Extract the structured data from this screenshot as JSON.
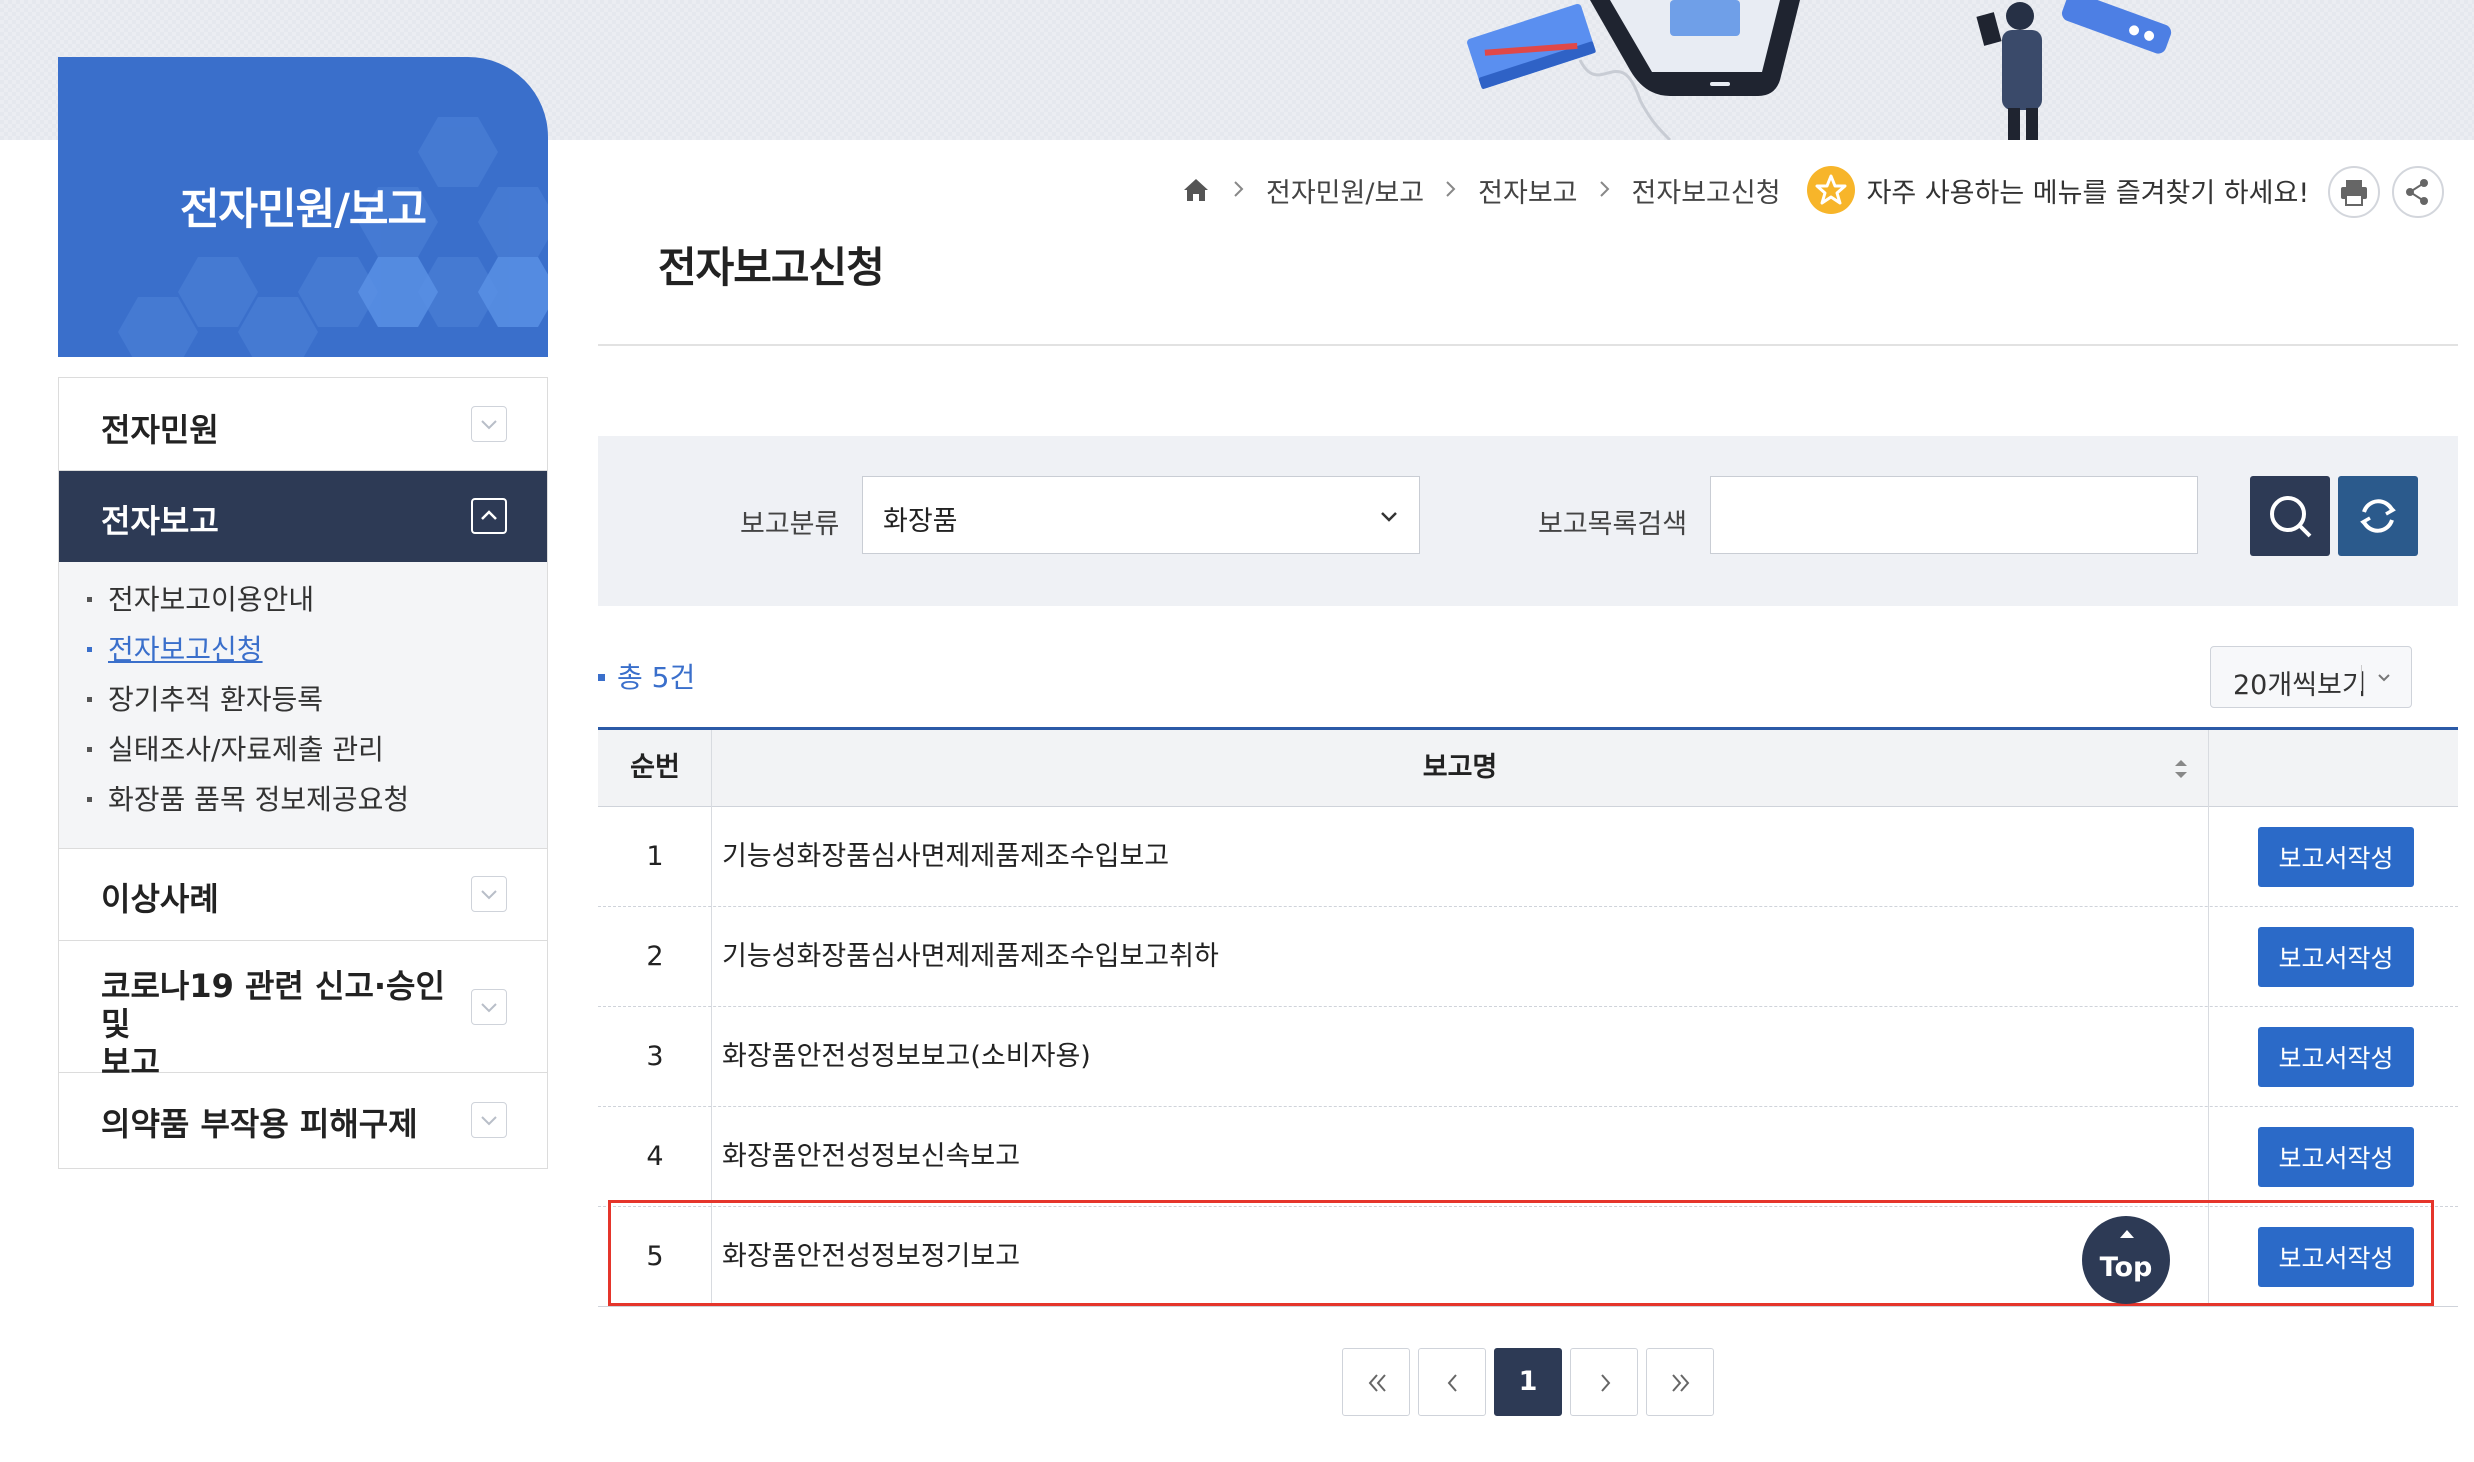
{
  "sidebar": {
    "title": "전자민원/보고",
    "menu": [
      {
        "label": "전자민원",
        "expanded": false
      },
      {
        "label": "전자보고",
        "expanded": true
      },
      {
        "label": "이상사례",
        "expanded": false
      },
      {
        "label": "코로나19 관련 신고·승인 및\n보고",
        "expanded": false
      },
      {
        "label": "의약품 부작용 피해구제",
        "expanded": false
      }
    ],
    "submenu": [
      {
        "label": "전자보고이용안내",
        "active": false
      },
      {
        "label": "전자보고신청",
        "active": true
      },
      {
        "label": "장기추적 환자등록",
        "active": false
      },
      {
        "label": "실태조사/자료제출 관리",
        "active": false
      },
      {
        "label": "화장품 품목 정보제공요청",
        "active": false
      }
    ]
  },
  "breadcrumb": {
    "home_icon": "home-icon",
    "items": [
      "전자민원/보고",
      "전자보고",
      "전자보고신청"
    ],
    "favorite_text": "자주 사용하는 메뉴를 즐겨찾기 하세요!"
  },
  "page_title": "전자보고신청",
  "search": {
    "category_label": "보고분류",
    "category_value": "화장품",
    "keyword_label": "보고목록검색",
    "keyword_value": "",
    "search_icon": "search-icon",
    "reset_icon": "refresh-icon"
  },
  "list": {
    "total_text": "총 5건",
    "page_size": "20개씩보기",
    "columns": [
      "순번",
      "보고명",
      ""
    ],
    "rows": [
      {
        "no": "1",
        "name": "기능성화장품심사면제제품제조수입보고",
        "action": "보고서작성"
      },
      {
        "no": "2",
        "name": "기능성화장품심사면제제품제조수입보고취하",
        "action": "보고서작성"
      },
      {
        "no": "3",
        "name": "화장품안전성정보보고(소비자용)",
        "action": "보고서작성"
      },
      {
        "no": "4",
        "name": "화장품안전성정보신속보고",
        "action": "보고서작성"
      },
      {
        "no": "5",
        "name": "화장품안전성정보정기보고",
        "action": "보고서작성"
      }
    ]
  },
  "top_button": "Top",
  "pagination": {
    "current": "1"
  },
  "colors": {
    "primary_blue": "#3a6fcb",
    "navy": "#2d3a55",
    "button_blue": "#2b6ac8",
    "highlight_red": "#e5352b"
  }
}
